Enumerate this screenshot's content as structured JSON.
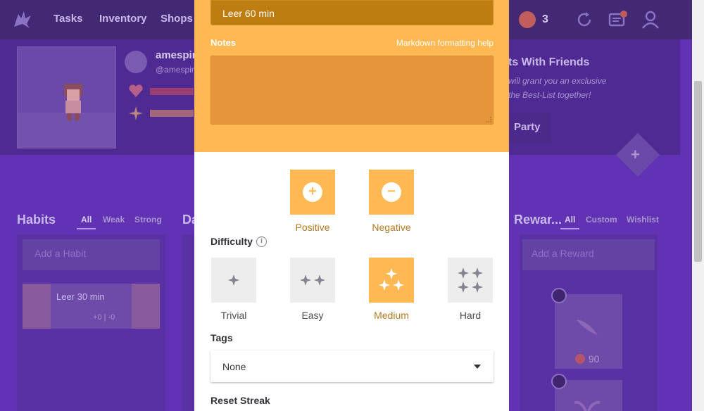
{
  "nav": {
    "items": [
      {
        "label": "Tasks"
      },
      {
        "label": "Inventory"
      },
      {
        "label": "Shops"
      }
    ],
    "gems_count": "3"
  },
  "header": {
    "username": "amespin",
    "handle": "@amespin",
    "party_title": "ts With Friends",
    "party_line1": "will grant you an exclusive",
    "party_line2": "the Best-List together!",
    "party_button": "Party"
  },
  "columns": {
    "habits": {
      "title": "Habits",
      "filters": [
        "All",
        "Weak",
        "Strong"
      ],
      "add_placeholder": "Add a Habit",
      "habit_text": "Leer 30 min",
      "habit_score": "+0 | -0"
    },
    "dailies": {
      "title": "Da"
    },
    "rewards": {
      "title": "Rewar...",
      "filters": [
        "All",
        "Custom",
        "Wishlist"
      ],
      "add_placeholder": "Add a Reward",
      "price": "90"
    }
  },
  "modal": {
    "title_value": "Leer 60 min",
    "notes_label": "Notes",
    "markdown_link": "Markdown formatting help",
    "notes_value": "",
    "positive_label": "Positive",
    "negative_label": "Negative",
    "difficulty_label": "Difficulty",
    "difficulty_options": [
      {
        "label": "Trivial",
        "selected": false
      },
      {
        "label": "Easy",
        "selected": false
      },
      {
        "label": "Medium",
        "selected": true
      },
      {
        "label": "Hard",
        "selected": false
      }
    ],
    "tags_label": "Tags",
    "tags_value": "None",
    "reset_streak_label": "Reset Streak"
  },
  "icons": {
    "info": "i",
    "plus": "+",
    "minus": "−"
  },
  "colors": {
    "modal_accent": "#ffb852",
    "title_input": "#bd7d11",
    "notes_area": "#e6963a",
    "selected_text": "#b57a1e",
    "app_background": "#6133b4"
  }
}
